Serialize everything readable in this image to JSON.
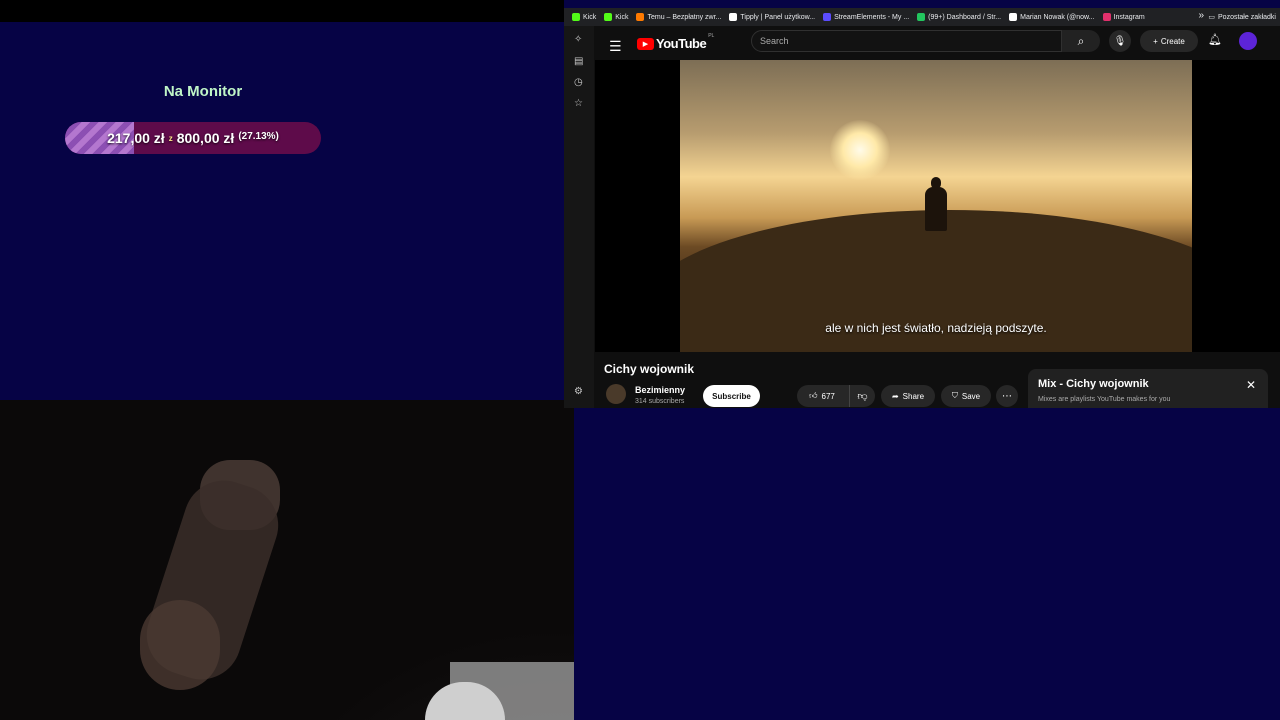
{
  "goal": {
    "title": "Na Monitor",
    "current": "217,00 zł",
    "separator": "z",
    "target": "800,00 zł",
    "percent_label": "(27.13%)",
    "progress": 0.2713
  },
  "browser": {
    "bookmarks": [
      {
        "label": "Kick",
        "color": "#53fc18"
      },
      {
        "label": "Kick",
        "color": "#53fc18"
      },
      {
        "label": "Temu – Bezpłatny zwr...",
        "color": "#ff7a00"
      },
      {
        "label": "Tipply | Panel użytkow...",
        "color": "#ffffff"
      },
      {
        "label": "StreamElements - My ...",
        "color": "#5b4cff"
      },
      {
        "label": "(99+) Dashboard / Str...",
        "color": "#22c55e"
      },
      {
        "label": "Marian Nowak (@now...",
        "color": "#ffffff"
      },
      {
        "label": "Instagram",
        "color": "#e1306c"
      }
    ],
    "other_bookmarks": "Pozostałe zakładki",
    "sidebar_icons": [
      "tools-icon",
      "document-icon",
      "history-icon",
      "star-icon",
      "settings-icon"
    ]
  },
  "youtube": {
    "logo_text": "YouTube",
    "region": "PL",
    "search_placeholder": "Search",
    "create_label": "Create",
    "caption": "ale w nich jest światło, nadzieją podszyte.",
    "video_title": "Cichy wojownik",
    "channel_name": "Bezimienny",
    "subscribers": "314 subscribers",
    "subscribe_label": "Subscribe",
    "likes": "677",
    "share_label": "Share",
    "save_label": "Save",
    "mix_title": "Mix - Cichy wojownik",
    "mix_subtitle": "Mixes are playlists YouTube makes for you"
  }
}
